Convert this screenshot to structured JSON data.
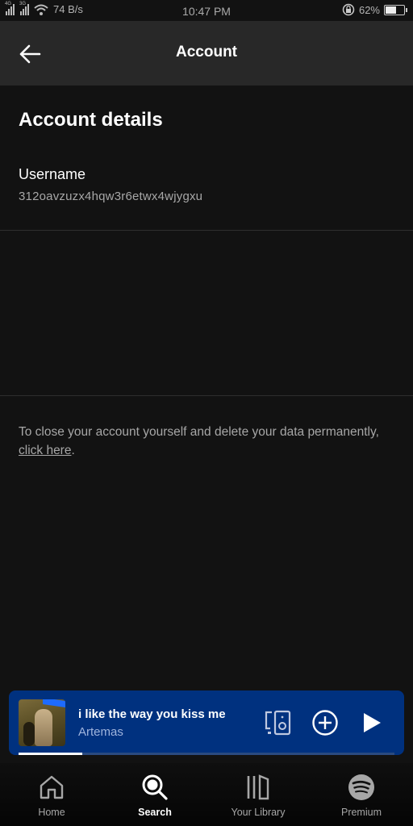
{
  "status_bar": {
    "network_1": "4G",
    "network_2": "3G",
    "speed": "74 B/s",
    "time": "10:47 PM",
    "battery_percent_label": "62%",
    "battery_level": 0.62
  },
  "header": {
    "title": "Account",
    "back_icon": "arrow-left-icon"
  },
  "account_details": {
    "section_title": "Account details",
    "username_label": "Username",
    "username_value": "312oavzuzx4hqw3r6etwx4wjygxu"
  },
  "close_account": {
    "text_before": "To close your account yourself and delete your data permanently, ",
    "link_text": "click here",
    "text_after": "."
  },
  "mini_player": {
    "track_title": "i like the way you kiss me",
    "artist": "Artemas",
    "progress": 0.17,
    "accent_color": "#00317f",
    "icons": [
      "connect-device-icon",
      "add-circle-icon",
      "play-icon"
    ]
  },
  "bottom_nav": {
    "items": [
      {
        "label": "Home",
        "icon": "home-icon",
        "active": false
      },
      {
        "label": "Search",
        "icon": "search-icon",
        "active": true
      },
      {
        "label": "Your Library",
        "icon": "library-icon",
        "active": false
      },
      {
        "label": "Premium",
        "icon": "spotify-icon",
        "active": false
      }
    ]
  }
}
